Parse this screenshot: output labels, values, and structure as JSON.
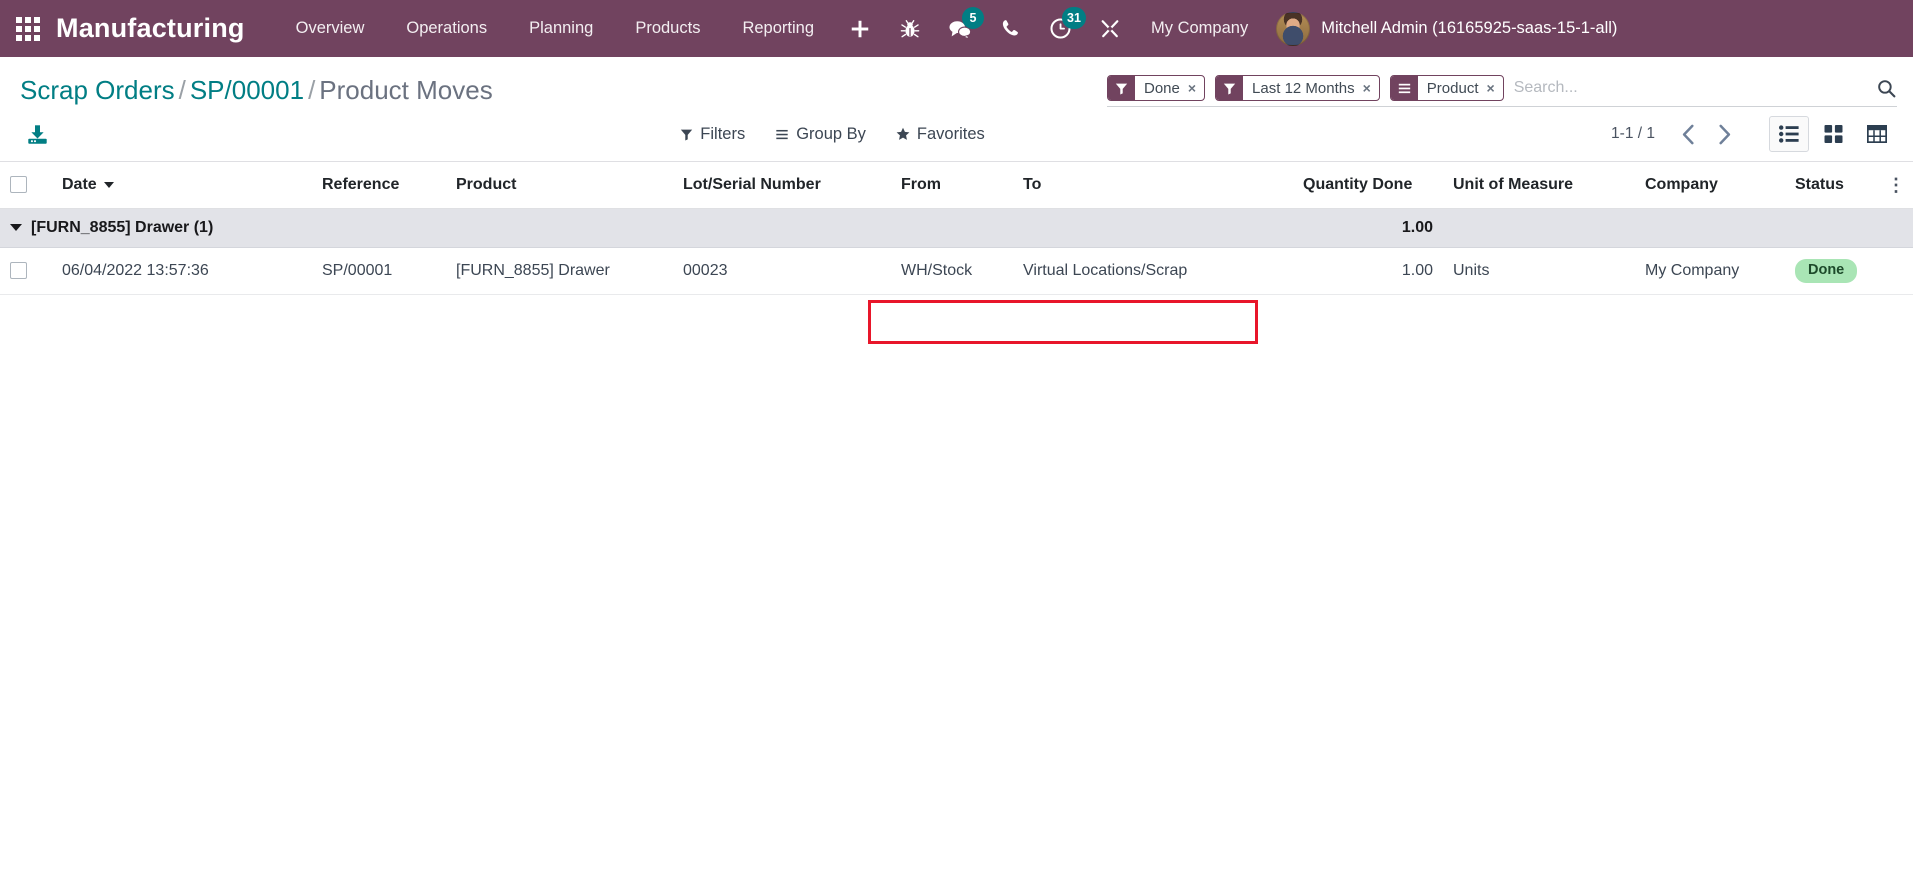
{
  "navbar": {
    "apps_icon": "apps-grid-icon",
    "brand": "Manufacturing",
    "menu_items": [
      {
        "label": "Overview",
        "name": "menu-overview"
      },
      {
        "label": "Operations",
        "name": "menu-operations"
      },
      {
        "label": "Planning",
        "name": "menu-planning"
      },
      {
        "label": "Products",
        "name": "menu-products"
      },
      {
        "label": "Reporting",
        "name": "menu-reporting"
      }
    ],
    "icons": [
      {
        "name": "plus-icon",
        "glyph": "+",
        "badge": null
      },
      {
        "name": "bug-icon",
        "glyph": "",
        "badge": null
      },
      {
        "name": "messages-icon",
        "glyph": "",
        "badge": "5"
      },
      {
        "name": "phone-icon",
        "glyph": "",
        "badge": null
      },
      {
        "name": "activities-clock-icon",
        "glyph": "",
        "badge": "31"
      },
      {
        "name": "tools-icon",
        "glyph": "",
        "badge": null
      }
    ],
    "company": "My Company",
    "user_name": "Mitchell Admin (16165925-saas-15-1-all)",
    "colors": {
      "navbar_bg": "#71435f",
      "badge_bg": "#017e84"
    }
  },
  "breadcrumb": {
    "item1": "Scrap Orders",
    "sep1": "/",
    "item2": "SP/00001",
    "sep2": "/",
    "item3": "Product Moves"
  },
  "search": {
    "placeholder": "Search...",
    "value": "",
    "facets": [
      {
        "label": "Done",
        "icon": "filter-icon",
        "remove": "×"
      },
      {
        "label": "Last 12 Months",
        "icon": "filter-icon",
        "remove": "×"
      },
      {
        "label": "Product",
        "icon": "group-by-icon",
        "remove": "×"
      }
    ],
    "magnifier": "search-icon"
  },
  "toolbar": {
    "export_icon": "download-export-icon",
    "filters_label": "Filters",
    "groupby_label": "Group By",
    "favorites_label": "Favorites",
    "pager": "1-1 / 1",
    "prev": "‹",
    "next": "›",
    "views": [
      {
        "name": "view-list",
        "label": "list-view-icon",
        "active": true
      },
      {
        "name": "view-kanban",
        "label": "kanban-view-icon",
        "active": false
      },
      {
        "name": "view-pivot",
        "label": "pivot-view-icon",
        "active": false
      }
    ]
  },
  "table": {
    "headers": [
      "Date",
      "Reference",
      "Product",
      "Lot/Serial Number",
      "From",
      "To",
      "Quantity Done",
      "Unit of Measure",
      "Company",
      "Status"
    ],
    "options_icon": "vertical-dots-icon",
    "group": {
      "label": "[FURN_8855] Drawer (1)",
      "quantity_total": "1.00"
    },
    "rows": [
      {
        "date": "06/04/2022 13:57:36",
        "reference": "SP/00001",
        "product": "[FURN_8855] Drawer",
        "lot_serial": "00023",
        "from": "WH/Stock",
        "to": "Virtual Locations/Scrap",
        "quantity_done": "1.00",
        "uom": "Units",
        "company": "My Company",
        "status": "Done"
      }
    ]
  },
  "annotation": {
    "color": "#e8162a",
    "highlights": "From and To location cells"
  }
}
